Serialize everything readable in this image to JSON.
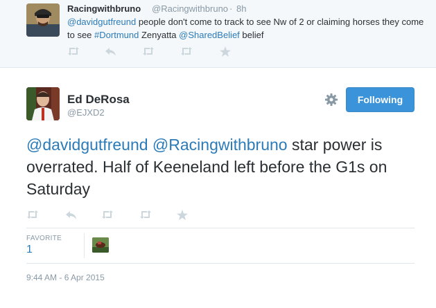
{
  "parent_tweet": {
    "name": "Racingwithbruno",
    "handle": "@Racingwithbruno",
    "separator": "·",
    "time": "8h",
    "text_parts": [
      {
        "text": "@davidgutfreund",
        "link": true
      },
      {
        "text": " people don't come to track to see Nw of 2 or claiming horses they come to see ",
        "link": false
      },
      {
        "text": "#Dortmund",
        "link": true
      },
      {
        "text": " Zenyatta ",
        "link": false
      },
      {
        "text": "@SharedBelief",
        "link": true
      },
      {
        "text": " belief",
        "link": false
      }
    ]
  },
  "main_tweet": {
    "name": "Ed DeRosa",
    "handle": "@EJXD2",
    "follow_label": "Following",
    "text_parts": [
      {
        "text": "@davidgutfreund",
        "link": true
      },
      {
        "text": " ",
        "link": false
      },
      {
        "text": "@Racingwithbruno",
        "link": true
      },
      {
        "text": " star power is overrated. Half of Keeneland left before the G1s on Saturday",
        "link": false
      }
    ],
    "favorite_label": "FAVORITE",
    "favorite_count": "1",
    "timestamp": "9:44 AM - 6 Apr 2015"
  },
  "icons": {
    "reply": "reply-icon",
    "retweet": "retweet-icon",
    "favorite": "star-icon",
    "more": "gear-icon"
  },
  "colors": {
    "link": "#2b7bb9",
    "follow_button": "#3b94d9",
    "muted": "#8899a6",
    "icon": "#ccd6dd"
  }
}
